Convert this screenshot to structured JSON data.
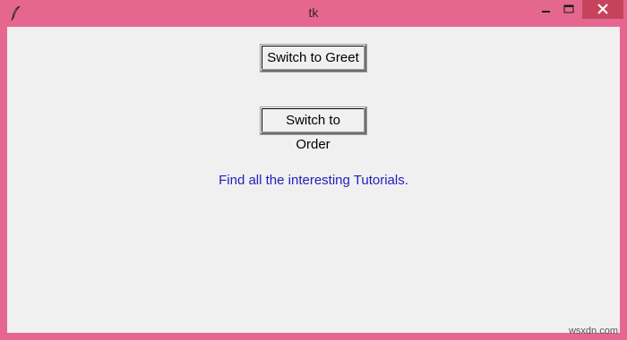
{
  "window": {
    "title": "tk",
    "frame_color": "#e5678f",
    "close_color": "#c7435b",
    "icon": "feather-icon"
  },
  "content": {
    "buttons": [
      {
        "label": "Switch to Greet"
      },
      {
        "label": "Switch to Order"
      }
    ],
    "message": "Find all the interesting Tutorials.",
    "message_color": "#1f1fbf"
  },
  "watermark": "wsxdn.com"
}
